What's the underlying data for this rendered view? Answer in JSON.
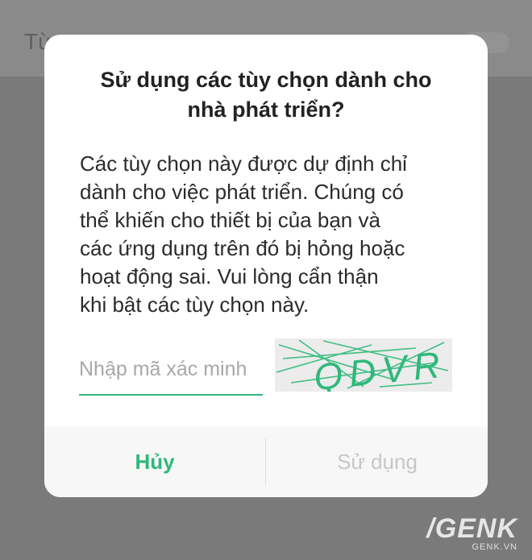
{
  "background": {
    "search_placeholder": "Từ"
  },
  "dialog": {
    "title": "Sử dụng các tùy chọn dành cho\nnhà phát triển?",
    "message": "Các tùy chọn này được dự định chỉ\ndành cho việc phát triển. Chúng có\nthể khiến cho thiết bị của bạn và\ncác ứng dụng trên đó bị hỏng hoặc\nhoạt động sai. Vui lòng cẩn thận\nkhi bật các tùy chọn này.",
    "verification": {
      "placeholder": "Nhập mã xác minh",
      "value": "",
      "captcha_text": "QDVR"
    },
    "buttons": {
      "cancel_label": "Hủy",
      "use_label": "Sử dụng"
    }
  },
  "watermark": {
    "logo": "/GENK",
    "domain": "GENK.VN"
  },
  "colors": {
    "accent": "#2fb87a",
    "disabled": "#c7c7c7",
    "scrim": "#7a7a7a"
  }
}
